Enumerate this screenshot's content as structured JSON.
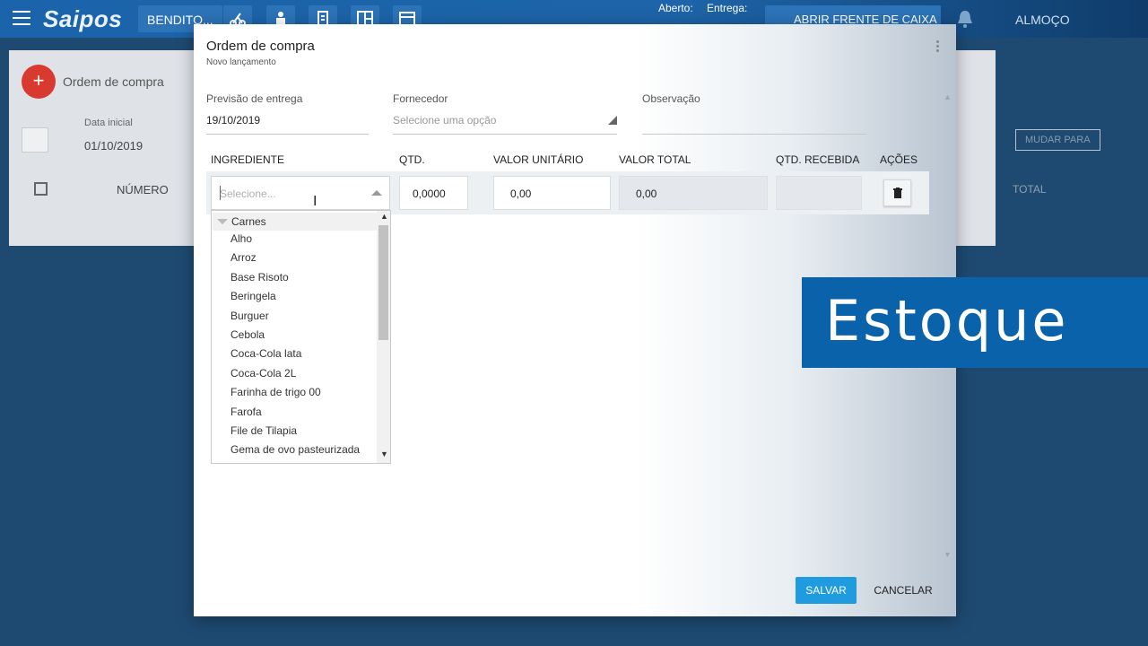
{
  "app": {
    "logo": "Saipos",
    "store_name": "BENDITO...",
    "status_open_label": "Aberto:",
    "delivery_label": "Entrega:",
    "open_register_label": "ABRIR FRENTE DE CAIXA",
    "shift_label": "ALMOÇO"
  },
  "background_page": {
    "title": "Ordem de compra",
    "date_label": "Data inicial",
    "date_value": "01/10/2019",
    "col_numero": "NÚMERO",
    "col_total": "TOTAL",
    "mudar_para": "MUDAR PARA"
  },
  "modal": {
    "title": "Ordem de compra",
    "subtitle": "Novo lançamento",
    "fields": {
      "delivery_label": "Previsão de entrega",
      "delivery_value": "19/10/2019",
      "supplier_label": "Fornecedor",
      "supplier_placeholder": "Selecione uma opção",
      "notes_label": "Observação"
    },
    "columns": [
      "INGREDIENTE",
      "QTD.",
      "VALOR UNITÁRIO",
      "VALOR TOTAL",
      "QTD. RECEBIDA",
      "AÇÕES"
    ],
    "row": {
      "ingredient_placeholder": "Selecione...",
      "qty": "0,0000",
      "unit_value": "0,00",
      "total_value": "0,00",
      "received_qty": ""
    },
    "dropdown": {
      "group": "Carnes",
      "options": [
        "Alho",
        "Arroz",
        "Base Risoto",
        "Beringela",
        "Burguer",
        "Cebola",
        "Coca-Cola lata",
        "Coca-Cola 2L",
        "Farinha de trigo 00",
        "Farofa",
        "File de Tilapia",
        "Gema de ovo pasteurizada"
      ]
    },
    "save_label": "SALVAR",
    "cancel_label": "CANCELAR"
  },
  "overlay": {
    "banner_text": "Estoque"
  },
  "colors": {
    "brand_blue": "#1b63aa",
    "save_button": "#1f9be0",
    "fab_red": "#d93a30",
    "banner_blue": "#0a63aa"
  }
}
